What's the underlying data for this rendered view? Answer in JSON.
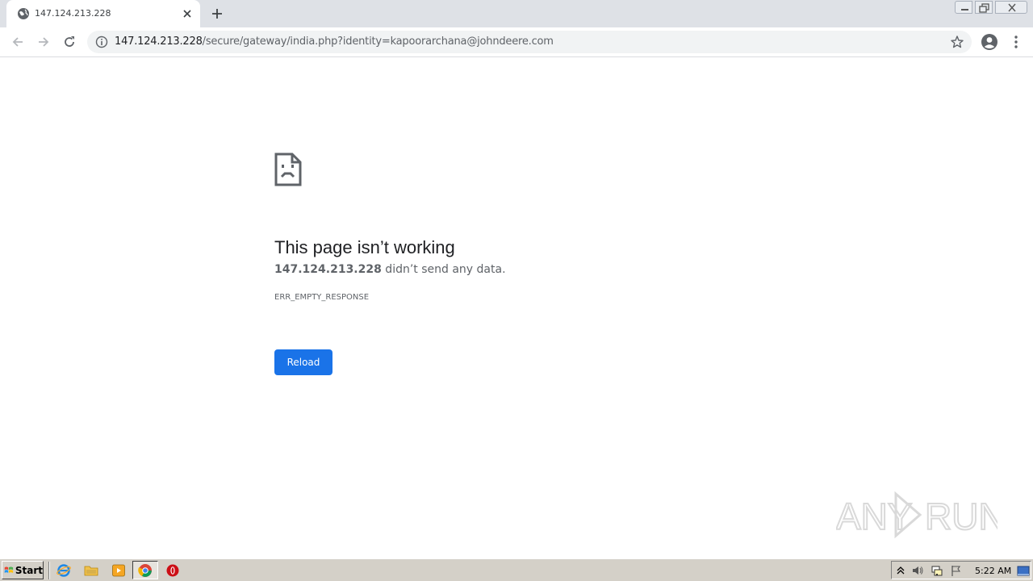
{
  "browser": {
    "tab": {
      "title": "147.124.213.228"
    },
    "address": {
      "host": "147.124.213.228",
      "path": "/secure/gateway/india.php?identity=kapoorarchana@johndeere.com"
    }
  },
  "error_page": {
    "title": "This page isn’t working",
    "host": "147.124.213.228",
    "description": " didn’t send any data.",
    "error_code": "ERR_EMPTY_RESPONSE",
    "reload_label": "Reload"
  },
  "taskbar": {
    "start_label": "Start",
    "clock": "5:22 AM"
  },
  "colors": {
    "accent": "#1a73e8",
    "tabstrip": "#dee1e6",
    "taskbar": "#d4d0c8"
  }
}
